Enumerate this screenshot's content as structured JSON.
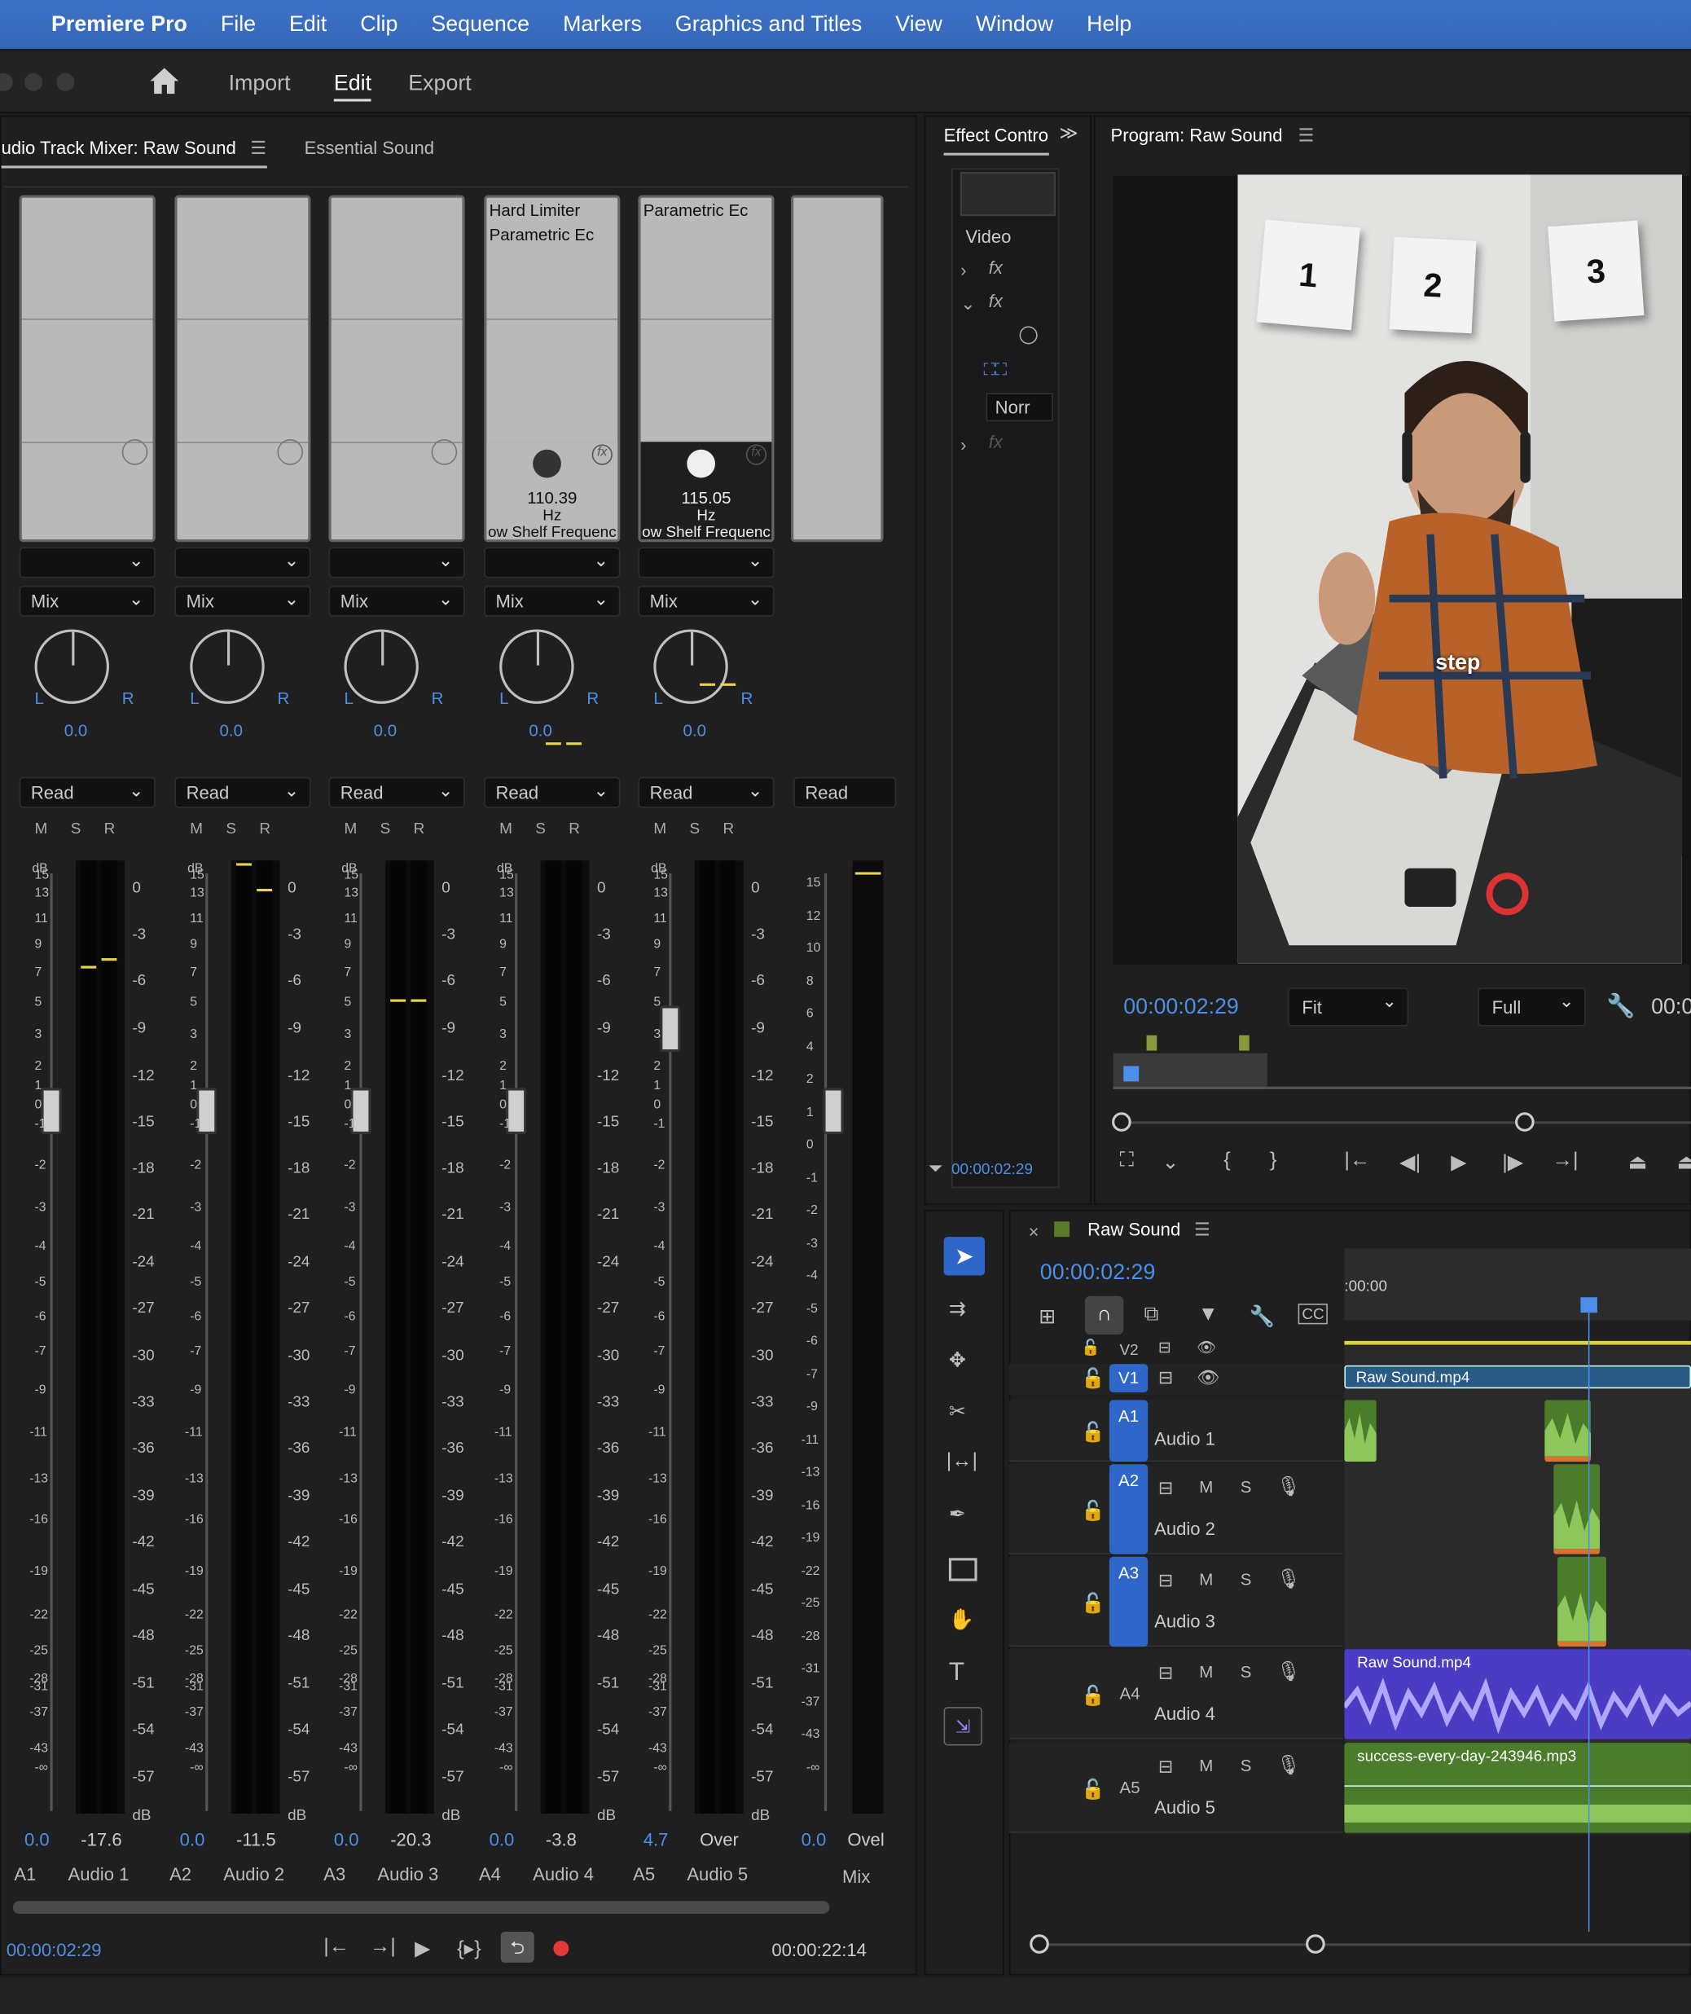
{
  "menubar": {
    "app_name": "Premiere Pro",
    "items": [
      "File",
      "Edit",
      "Clip",
      "Sequence",
      "Markers",
      "Graphics and Titles",
      "View",
      "Window",
      "Help"
    ]
  },
  "workspace": {
    "import": "Import",
    "edit": "Edit",
    "export": "Export"
  },
  "mixer": {
    "tab_title": "udio Track Mixer: Raw Sound",
    "tab_essential": "Essential Sound",
    "mode_label": "Mix",
    "automation_label": "Read",
    "msr": "MSR",
    "db_label": "dB",
    "left_scale": [
      "15",
      "13",
      "11",
      "9",
      "7",
      "5",
      "3",
      "2",
      "1",
      "0",
      "-1",
      "-2",
      "-3",
      "-4",
      "-5",
      "-6",
      "-7",
      "-9",
      "-11",
      "-13",
      "-16",
      "-19",
      "-22",
      "-25",
      "-28",
      "-31",
      "-37",
      "-43",
      "-∞"
    ],
    "right_scale": [
      "0",
      "-3",
      "-6",
      "-9",
      "-12",
      "-15",
      "-18",
      "-21",
      "-24",
      "-27",
      "-30",
      "-33",
      "-36",
      "-39",
      "-42",
      "-45",
      "-48",
      "-51",
      "-54",
      "-57",
      "dB"
    ],
    "channels": [
      {
        "id": "A1",
        "name": "Audio 1",
        "pan": "0.0",
        "volume": "0.0",
        "level": "-17.6",
        "fx1": "",
        "fx2": "",
        "knob_value": "",
        "knob_unit": "",
        "knob_param": ""
      },
      {
        "id": "A2",
        "name": "Audio 2",
        "pan": "0.0",
        "volume": "0.0",
        "level": "-11.5",
        "fx1": "",
        "fx2": "",
        "knob_value": "",
        "knob_unit": "",
        "knob_param": ""
      },
      {
        "id": "A3",
        "name": "Audio 3",
        "pan": "0.0",
        "volume": "0.0",
        "level": "-20.3",
        "fx1": "",
        "fx2": "",
        "knob_value": "",
        "knob_unit": "",
        "knob_param": ""
      },
      {
        "id": "A4",
        "name": "Audio 4",
        "pan": "0.0",
        "volume": "0.0",
        "level": "-3.8",
        "fx1": "Hard Limiter",
        "fx2": "Parametric Ec",
        "knob_value": "110.39",
        "knob_unit": "Hz",
        "knob_param": "ow Shelf Frequenc"
      },
      {
        "id": "A5",
        "name": "Audio 5",
        "pan": "0.0",
        "volume": "4.7",
        "level": "Over",
        "fx1": "Parametric Ec",
        "fx2": "",
        "knob_value": "115.05",
        "knob_unit": "Hz",
        "knob_param": "ow Shelf Frequenc"
      }
    ],
    "master": {
      "name": "Mix",
      "volume": "0.0",
      "level": "Ovel",
      "automation": "Read",
      "scale": [
        "15",
        "12",
        "10",
        "8",
        "6",
        "4",
        "2",
        "1",
        "0",
        "-1",
        "-2",
        "-3",
        "-4",
        "-5",
        "-6",
        "-7",
        "-9",
        "-11",
        "-13",
        "-16",
        "-19",
        "-22",
        "-25",
        "-28",
        "-31",
        "-37",
        "-43",
        "-∞"
      ]
    },
    "current_time": "00:00:02:29",
    "duration": "00:00:22:14"
  },
  "effect_controls": {
    "tab_title": "Effect Contro",
    "video_label": "Video",
    "normal_label": "Norr",
    "fx_label": "fx",
    "time": "00:00:02:29"
  },
  "program": {
    "tab_title": "Program: Raw Sound",
    "timecode": "00:00:02:29",
    "fit": "Fit",
    "full": "Full",
    "time_right": "00:0",
    "caption": "step",
    "cards": [
      "1",
      "2",
      "3"
    ]
  },
  "timeline": {
    "tab_title": "Raw Sound",
    "timecode": "00:00:02:29",
    "ruler_start": ":00:00",
    "v2": "V2",
    "v1": "V1",
    "video_clip": "Raw Sound.mp4",
    "tracks": [
      {
        "id": "A1",
        "name": "Audio 1"
      },
      {
        "id": "A2",
        "name": "Audio 2"
      },
      {
        "id": "A3",
        "name": "Audio 3"
      },
      {
        "id": "A4",
        "name": "Audio 4"
      },
      {
        "id": "A5",
        "name": "Audio 5"
      }
    ],
    "a4_clip": "Raw Sound.mp4",
    "a5_clip": "success-every-day-243946.mp3",
    "m": "M",
    "s": "S"
  },
  "colors": {
    "accent": "#2f66c9",
    "timecode": "#4d8fe8",
    "audio_clip": "#4a7c2b",
    "video_clip": "#2a5a86",
    "purple_clip": "#4b3cc4",
    "meter_peak": "#e8d34a"
  }
}
